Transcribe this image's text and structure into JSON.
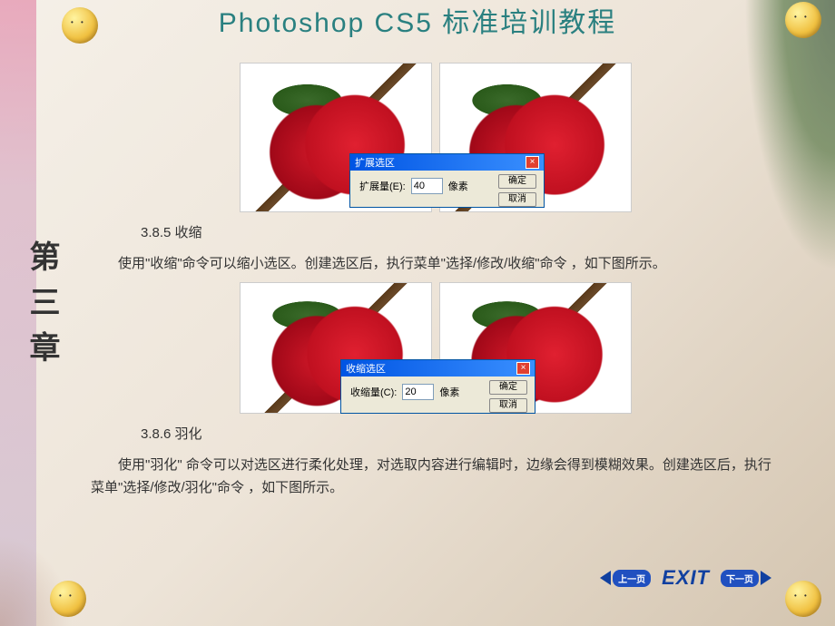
{
  "title": "Photoshop CS5 标准培训教程",
  "chapter": "第三章",
  "sections": {
    "s385": {
      "heading": "3.8.5  收缩",
      "body": "使用\"收缩\"命令可以缩小选区。创建选区后，执行菜单\"选择/修改/收缩\"命令 ，如下图所示。"
    },
    "s386": {
      "heading": "3.8.6  羽化",
      "body": "使用\"羽化\" 命令可以对选区进行柔化处理，对选取内容进行编辑时，边缘会得到模糊效果。创建选区后，执行菜单\"选择/修改/羽化\"命令 ，如下图所示。"
    }
  },
  "dialogs": {
    "expand": {
      "title": "扩展选区",
      "label": "扩展量(E):",
      "value": "40",
      "unit": "像素",
      "ok": "确定",
      "cancel": "取消"
    },
    "contract": {
      "title": "收缩选区",
      "label": "收缩量(C):",
      "value": "20",
      "unit": "像素",
      "ok": "确定",
      "cancel": "取消"
    }
  },
  "nav": {
    "prev": "上一页",
    "next": "下一页",
    "exit": "EXIT"
  }
}
